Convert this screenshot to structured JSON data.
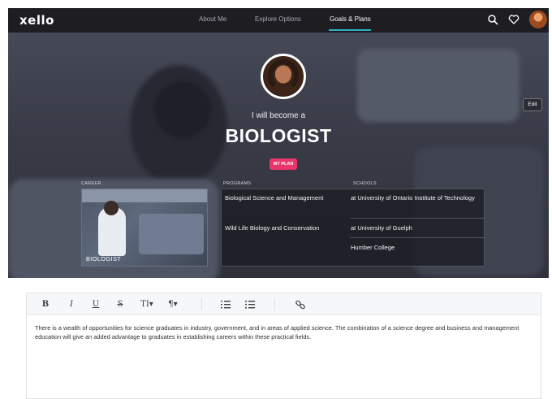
{
  "nav": {
    "logo": "xello",
    "links": [
      "About Me",
      "Explore Options",
      "Goals & Plans"
    ],
    "active": "Goals & Plans",
    "accent": "#2fb2c4",
    "icons": [
      "search-icon",
      "heart-icon",
      "user-avatar"
    ]
  },
  "hero": {
    "subtitle": "I will become a",
    "title": "BIOLOGIST",
    "badge": "MY PLAN",
    "badge_color": "#e8356b",
    "edit_label": "Edit",
    "career_label": "CAREER",
    "programs_label": "PROGRAMS",
    "schools_label": "SCHOOLS",
    "career_card_label": "BIOLOGIST",
    "programs": [
      {
        "program": "Biological Science and Management",
        "school": "at University of Ontario Institute of Technology"
      },
      {
        "program": "Wild Life Biology and Conservation",
        "school": "at University of Guelph"
      },
      {
        "program": "",
        "school": "Humber College"
      }
    ]
  },
  "editor": {
    "toolbar": [
      "B",
      "I",
      "U",
      "S",
      "TI▾",
      "¶▾",
      "ordered-list-icon",
      "bullet-list-icon",
      "link-icon"
    ],
    "text": "There is a wealth of opportunities for science graduates in industry, government, and in areas of applied science. The combination of a science degree and business and management education will give an added advantage to graduates in establishing careers within these practical fields."
  }
}
